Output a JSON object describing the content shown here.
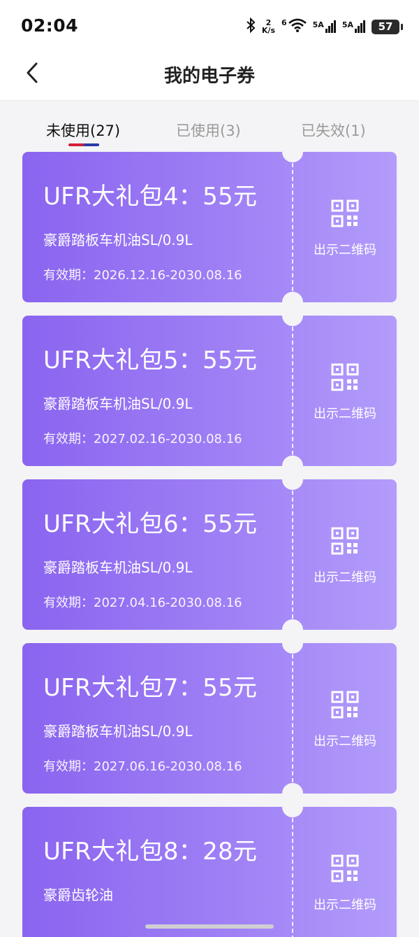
{
  "status_bar": {
    "time": "02:04",
    "net_speed_value": "2",
    "net_speed_unit": "K/s",
    "wifi_label": "6",
    "sim1_label": "5A",
    "sim2_label": "5A",
    "battery": "57"
  },
  "header": {
    "title": "我的电子券"
  },
  "tabs": [
    {
      "label": "未使用(27)",
      "active": true
    },
    {
      "label": "已使用(3)",
      "active": false
    },
    {
      "label": "已失效(1)",
      "active": false
    }
  ],
  "coupons": [
    {
      "title": "UFR大礼包4：55元",
      "desc": "豪爵踏板车机油SL/0.9L",
      "validity": "有效期：2026.12.16-2030.08.16",
      "action": "出示二维码"
    },
    {
      "title": "UFR大礼包5：55元",
      "desc": "豪爵踏板车机油SL/0.9L",
      "validity": "有效期：2027.02.16-2030.08.16",
      "action": "出示二维码"
    },
    {
      "title": "UFR大礼包6：55元",
      "desc": "豪爵踏板车机油SL/0.9L",
      "validity": "有效期：2027.04.16-2030.08.16",
      "action": "出示二维码"
    },
    {
      "title": "UFR大礼包7：55元",
      "desc": "豪爵踏板车机油SL/0.9L",
      "validity": "有效期：2027.06.16-2030.08.16",
      "action": "出示二维码"
    },
    {
      "title": "UFR大礼包8：28元",
      "desc": "豪爵齿轮油",
      "validity": "",
      "action": "出示二维码"
    }
  ],
  "colors": {
    "coupon_gradient_start": "#8a64ef",
    "coupon_gradient_end": "#b39cfb",
    "tab_indicator_red": "#d51f3a",
    "tab_indicator_blue": "#2b3aa8"
  },
  "icons": {
    "back": "chevron-left-icon",
    "qr": "qr-code-icon",
    "bluetooth": "bluetooth-icon",
    "wifi": "wifi-icon",
    "signal": "signal-icon",
    "battery": "battery-icon"
  }
}
